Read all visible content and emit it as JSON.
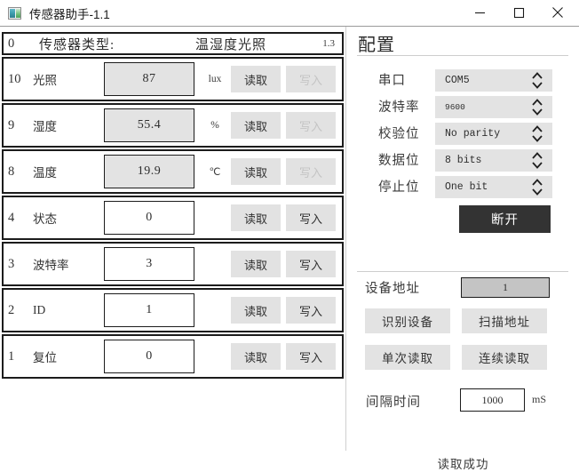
{
  "window": {
    "title": "传感器助手-1.1",
    "icon": "app-image-icon",
    "controls": {
      "minimize": "minimize-icon",
      "maximize": "maximize-icon",
      "close": "close-icon"
    }
  },
  "left_panel": {
    "header": {
      "index": "0",
      "label": "传感器类型:",
      "type": "温湿度光照",
      "version": "1.3"
    },
    "read_label": "读取",
    "write_label": "写入",
    "rows": [
      {
        "index": "10",
        "label": "光照",
        "value": "87",
        "unit": "lux",
        "readonly": true,
        "write_enabled": false
      },
      {
        "index": "9",
        "label": "湿度",
        "value": "55.4",
        "unit": "%",
        "readonly": true,
        "write_enabled": false
      },
      {
        "index": "8",
        "label": "温度",
        "value": "19.9",
        "unit": "℃",
        "readonly": true,
        "write_enabled": false
      },
      {
        "index": "4",
        "label": "状态",
        "value": "0",
        "unit": "",
        "readonly": false,
        "write_enabled": true
      },
      {
        "index": "3",
        "label": "波特率",
        "value": "3",
        "unit": "",
        "readonly": false,
        "write_enabled": true
      },
      {
        "index": "2",
        "label": "ID",
        "value": "1",
        "unit": "",
        "readonly": false,
        "write_enabled": true
      },
      {
        "index": "1",
        "label": "复位",
        "value": "0",
        "unit": "",
        "readonly": false,
        "write_enabled": true
      }
    ]
  },
  "right_panel": {
    "title": "配置",
    "serial": [
      {
        "label": "串口",
        "value": "COM5",
        "small": false
      },
      {
        "label": "波特率",
        "value": "9600",
        "small": true
      },
      {
        "label": "校验位",
        "value": "No parity",
        "small": false
      },
      {
        "label": "数据位",
        "value": "8 bits",
        "small": false
      },
      {
        "label": "停止位",
        "value": "One bit",
        "small": false
      }
    ],
    "disconnect_label": "断开",
    "device_address_label": "设备地址",
    "device_address_value": "1",
    "buttons": {
      "identify": "识别设备",
      "scan": "扫描地址",
      "read_once": "单次读取",
      "read_continuous": "连续读取"
    },
    "interval_label": "间隔时间",
    "interval_value": "1000",
    "interval_unit": "mS",
    "status": "读取成功"
  },
  "colors": {
    "accent_dark": "#333333",
    "panel_gray": "#e3e3e3",
    "field_gray": "#c4c4c4",
    "border": "#1c1c1c"
  }
}
